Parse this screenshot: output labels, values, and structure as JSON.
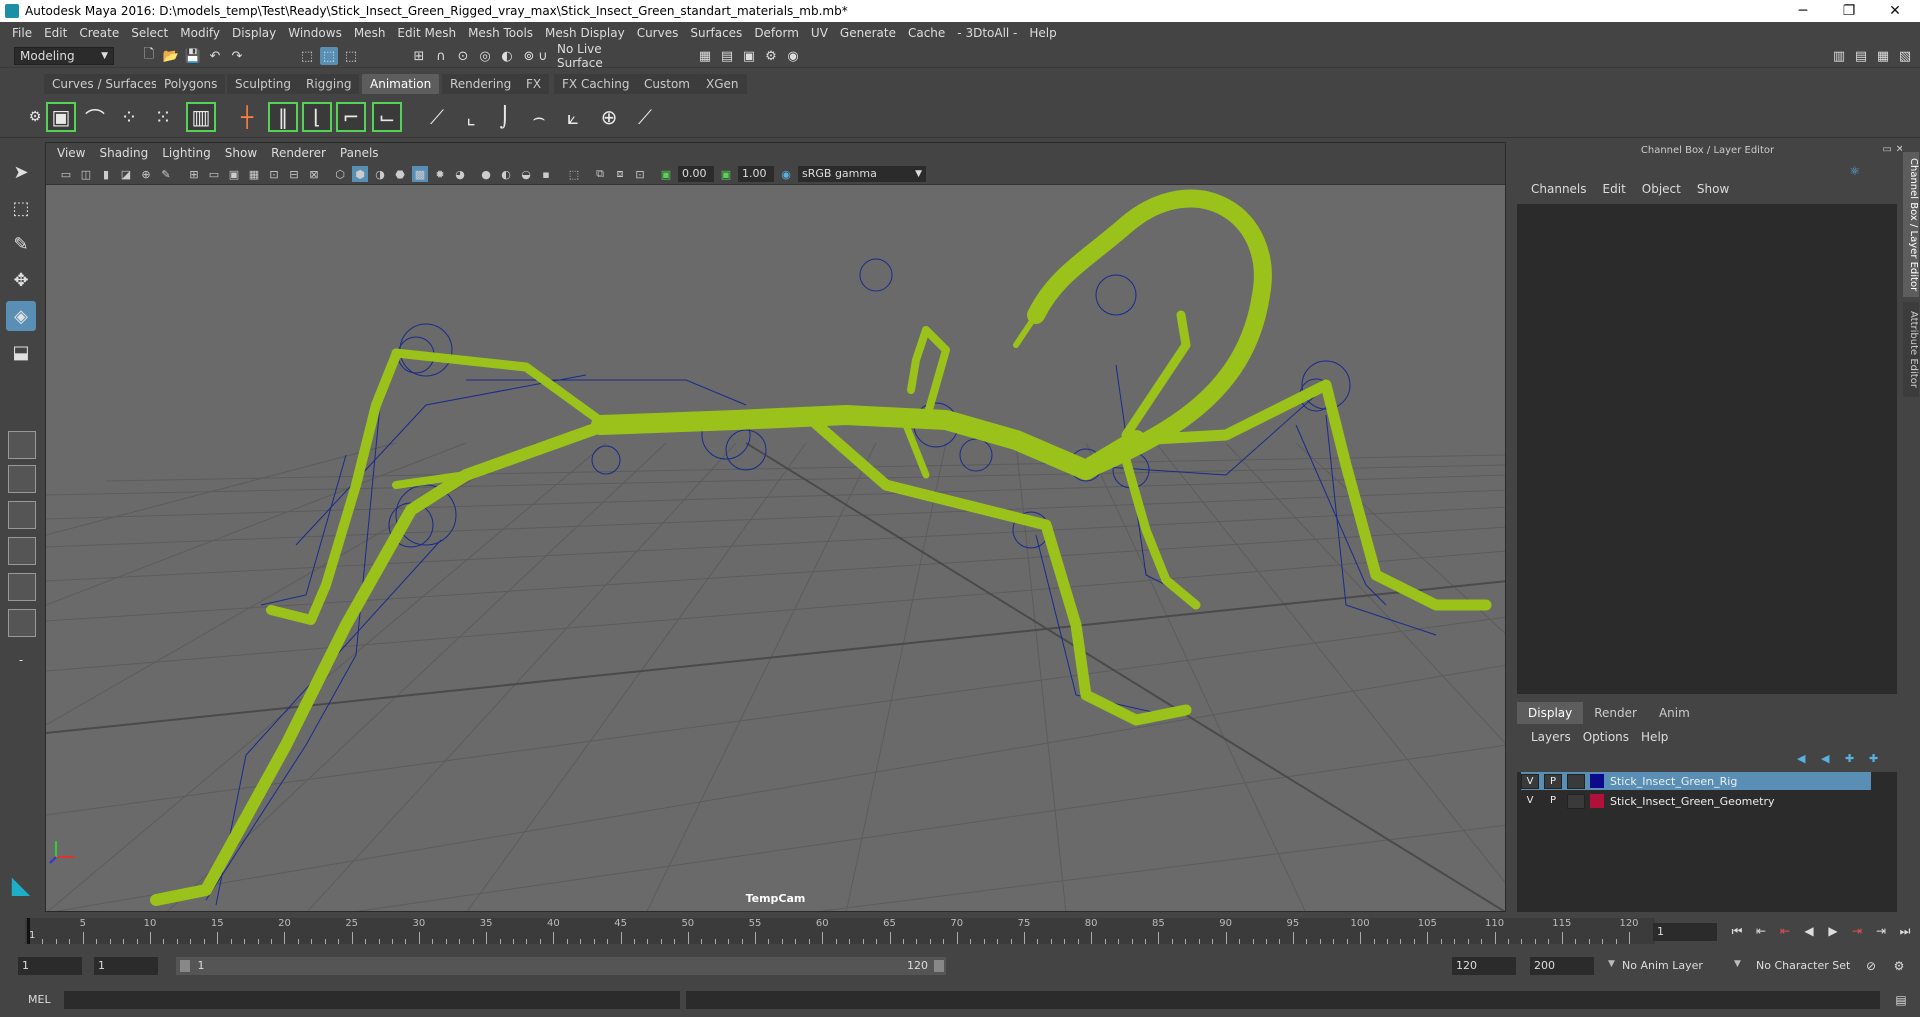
{
  "window": {
    "title": "Autodesk Maya 2016: D:\\models_temp\\Test\\Ready\\Stick_Insect_Green_Rigged_vray_max\\Stick_Insect_Green_standart_materials_mb.mb*",
    "minimize": "─",
    "restore": "❐",
    "close": "✕"
  },
  "menubar": [
    "File",
    "Edit",
    "Create",
    "Select",
    "Modify",
    "Display",
    "Windows",
    "Mesh",
    "Edit Mesh",
    "Mesh Tools",
    "Mesh Display",
    "Curves",
    "Surfaces",
    "Deform",
    "UV",
    "Generate",
    "Cache",
    "- 3DtoAll -",
    "Help"
  ],
  "statusline": {
    "menuset": "Modeling",
    "live_surface": "No Live Surface"
  },
  "shelf_tabs": [
    "Curves / Surfaces",
    "Polygons",
    "Sculpting",
    "Rigging",
    "Animation",
    "Rendering",
    "FX",
    "FX Caching",
    "Custom",
    "XGen"
  ],
  "shelf_active_tab": "Animation",
  "viewport": {
    "menu": [
      "View",
      "Shading",
      "Lighting",
      "Show",
      "Renderer",
      "Panels"
    ],
    "exposure": "0.00",
    "gamma": "1.00",
    "colorspace": "sRGB gamma",
    "camera_label": "TempCam",
    "colors": {
      "background": "#6a6a6a",
      "mesh": "#9bc21a",
      "rig": "#1a2a8c",
      "grid": "#5a5a5a"
    }
  },
  "channel_box": {
    "title": "Channel Box / Layer Editor",
    "menu": [
      "Channels",
      "Edit",
      "Object",
      "Show"
    ],
    "layer_tabs": [
      "Display",
      "Render",
      "Anim"
    ],
    "layer_menu": [
      "Layers",
      "Options",
      "Help"
    ],
    "layers": [
      {
        "v": "V",
        "p": "P",
        "color": "#0a0a8a",
        "name": "Stick_Insect_Green_Rig",
        "selected": true
      },
      {
        "v": "V",
        "p": "P",
        "color": "#b0103a",
        "name": "Stick_Insect_Green_Geometry",
        "selected": false
      }
    ],
    "side_tabs": [
      "Channel Box / Layer Editor",
      "Attribute Editor"
    ]
  },
  "timeline": {
    "ticks": [
      "5",
      "10",
      "15",
      "20",
      "25",
      "30",
      "35",
      "40",
      "45",
      "50",
      "55",
      "60",
      "65",
      "70",
      "75",
      "80",
      "85",
      "90",
      "95",
      "100",
      "105",
      "110",
      "115",
      "120"
    ],
    "start_marker": "1",
    "current_frame": "1"
  },
  "range": {
    "start": "1",
    "anim_start": "1",
    "range_start": "1",
    "range_end": "120",
    "anim_end": "120",
    "end": "200",
    "anim_layer": "No Anim Layer",
    "character_set": "No Character Set"
  },
  "cmdline": {
    "label": "MEL"
  }
}
